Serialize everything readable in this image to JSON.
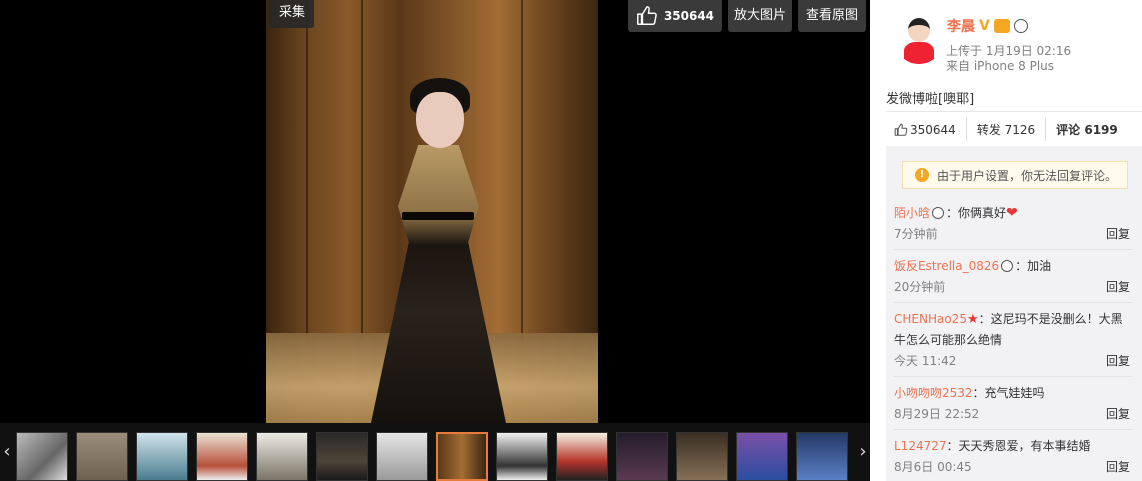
{
  "viewer": {
    "collect_label": "采集",
    "like_count": "350644",
    "enlarge_label": "放大图片",
    "original_label": "查看原图",
    "prev_arrow": "‹",
    "next_arrow": "›",
    "thumbnail_count": 14,
    "active_thumbnail_index": 7
  },
  "post": {
    "username": "李晨",
    "verified_mark": "V",
    "upload_time": "上传于 1月19日 02:16",
    "device": "来自 iPhone 8 Plus",
    "text": "发微博啦[噢耶]"
  },
  "stats": {
    "likes": "350644",
    "reposts": "转发 7126",
    "comments": "评论 6199"
  },
  "notice": {
    "icon": "!",
    "text": "由于用户设置，你无法回复评论。"
  },
  "comments": [
    {
      "author": "陌小晗",
      "text": "：你俩真好",
      "time": "7分钟前",
      "reply": "回复"
    },
    {
      "author": "饭反Estrella_0826",
      "text": "：加油",
      "time": "20分钟前",
      "reply": "回复"
    },
    {
      "author": "CHENHao25",
      "text": "：这尼玛不是没删么！大黑牛怎么可能那么绝情",
      "time": "今天 11:42",
      "reply": "回复"
    },
    {
      "author": "小吻吻吻2532",
      "text": "：充气娃娃吗",
      "time": "8月29日 22:52",
      "reply": "回复"
    },
    {
      "author": "L124727",
      "text": "：天天秀恩爱，有本事结婚",
      "time": "8月6日 00:45",
      "reply": "回复"
    }
  ],
  "colors": {
    "accent": "#eb7350",
    "active_thumb_border": "#e77d3a",
    "badge": "#f5a623"
  }
}
